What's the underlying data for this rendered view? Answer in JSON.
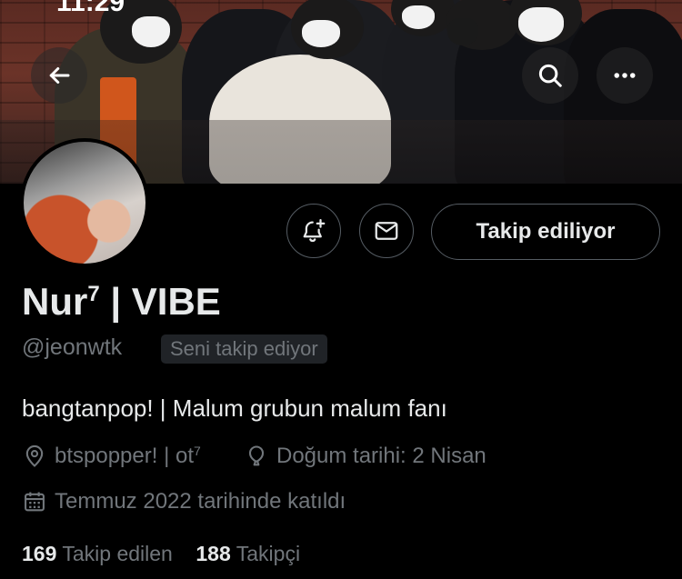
{
  "status_bar": {
    "time": "11:29"
  },
  "header": {
    "back_icon": "arrow-left-icon",
    "search_icon": "search-icon",
    "more_icon": "more-horizontal-icon"
  },
  "profile": {
    "name": "Nur",
    "name_superscript": "7",
    "name_suffix": " | VIBE",
    "handle": "@jeonwtk",
    "follows_you_badge": "Seni takip ediyor",
    "bio": "bangtanpop! | Malum grubun malum fanı",
    "location": "btspopper! | ot",
    "location_superscript": "7",
    "birthday": "Doğum tarihi: 2 Nisan",
    "joined": "Temmuz 2022 tarihinde katıldı",
    "following_count": "169",
    "following_label": "Takip edilen",
    "followers_count": "188",
    "followers_label": "Takipçi"
  },
  "actions": {
    "notify_icon": "bell-plus-icon",
    "message_icon": "envelope-icon",
    "follow_button_label": "Takip ediliyor"
  },
  "colors": {
    "background": "#000000",
    "text_primary": "#e7e9ea",
    "text_secondary": "#71767b",
    "border": "#555c63",
    "badge_bg": "#202327"
  }
}
